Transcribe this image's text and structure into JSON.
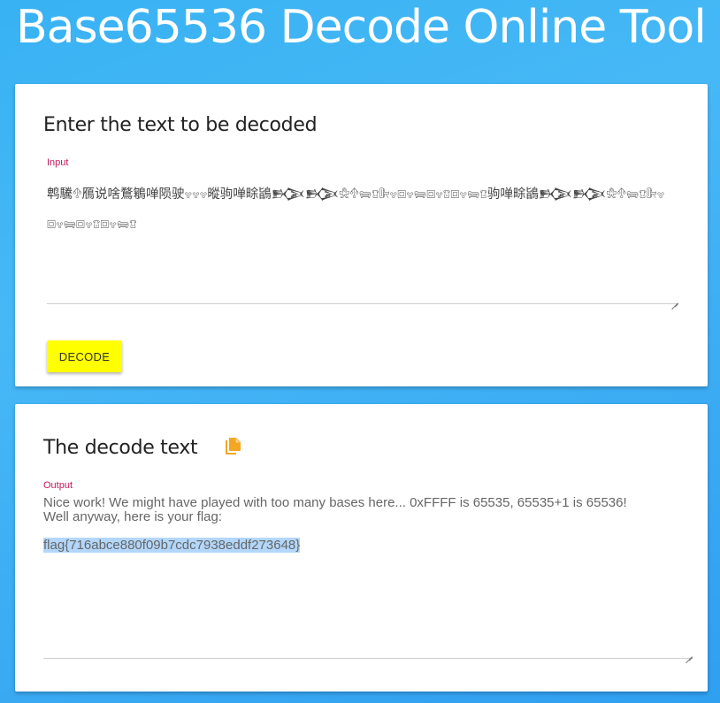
{
  "page": {
    "title": "Base65536 Decode Online Tool"
  },
  "input_card": {
    "title": "Enter the text to be decoded",
    "label": "Input",
    "value": "鹎驣𔔯鴈说啥鶩鵴啴陨驶𔗈𔗈𔗈暰驹啴畭鴲𒁡𒁡𔖡𔔯𔕓𔖈𔕢𔗈𔔢𔗈𔕓𔔢𔗈𔖈𔔢𔗈𔕓𔖈驹啴畭鴲𒁡𒁡𔖡𔔯𔕓𔖈𔕢𔗈𔔢𔗈𔕓𔔢𔗈𔖈𔔢𔗈𔕓𔖈"
  },
  "decode_button": {
    "label": "DECODE"
  },
  "output_card": {
    "title": "The decode text",
    "label": "Output",
    "text_line1": "Nice work! We might have played with too many bases here... 0xFFFF is 65535, 65535+1 is 65536!",
    "text_line2": "Well anyway, here is your flag:",
    "flag": "flag{716abce880f09b7cdc7938eddf273648}"
  },
  "icons": {
    "copy": "copy-icon"
  },
  "colors": {
    "accent_button": "#ffff00",
    "label_red": "#c2185b",
    "copy_icon": "#f5a623",
    "selection": "#b3d7fb"
  }
}
